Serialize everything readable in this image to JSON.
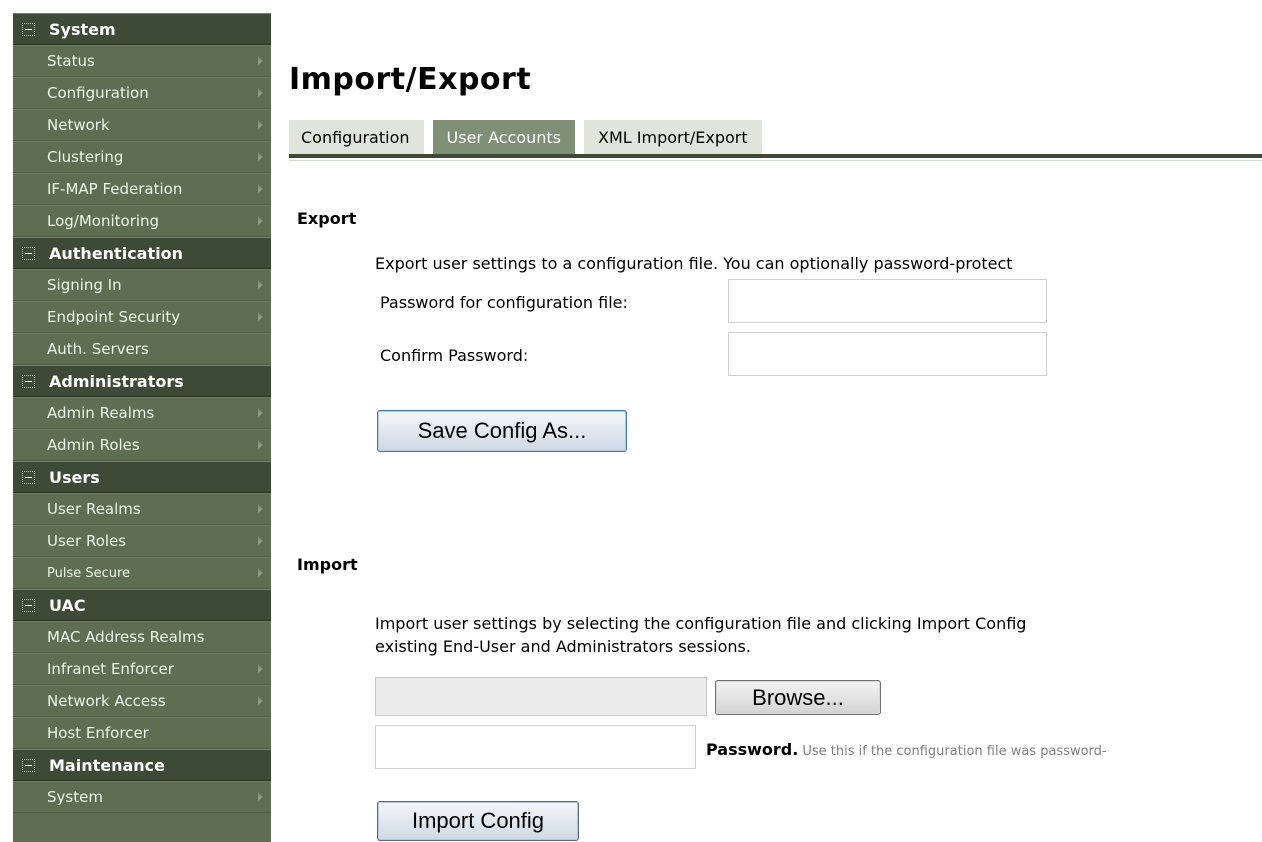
{
  "sidebar": {
    "sections": [
      {
        "title": "System",
        "items": [
          {
            "label": "Status",
            "arrow": true
          },
          {
            "label": "Configuration",
            "arrow": true
          },
          {
            "label": "Network",
            "arrow": true
          },
          {
            "label": "Clustering",
            "arrow": true
          },
          {
            "label": "IF-MAP Federation",
            "arrow": true
          },
          {
            "label": "Log/Monitoring",
            "arrow": true
          }
        ]
      },
      {
        "title": "Authentication",
        "items": [
          {
            "label": "Signing In",
            "arrow": true
          },
          {
            "label": "Endpoint Security",
            "arrow": true
          },
          {
            "label": "Auth. Servers",
            "arrow": false
          }
        ]
      },
      {
        "title": "Administrators",
        "items": [
          {
            "label": "Admin Realms",
            "arrow": true
          },
          {
            "label": "Admin Roles",
            "arrow": true
          }
        ]
      },
      {
        "title": "Users",
        "items": [
          {
            "label": "User Realms",
            "arrow": true
          },
          {
            "label": "User Roles",
            "arrow": true
          },
          {
            "label": "Pulse Secure",
            "arrow": true,
            "small": true
          }
        ]
      },
      {
        "title": "UAC",
        "items": [
          {
            "label": "MAC Address Realms",
            "arrow": false
          },
          {
            "label": "Infranet Enforcer",
            "arrow": true
          },
          {
            "label": "Network Access",
            "arrow": true
          },
          {
            "label": "Host Enforcer",
            "arrow": false
          }
        ]
      },
      {
        "title": "Maintenance",
        "items": [
          {
            "label": "System",
            "arrow": true
          }
        ]
      }
    ]
  },
  "page": {
    "title": "Import/Export"
  },
  "tabs": [
    {
      "label": "Configuration",
      "active": false
    },
    {
      "label": "User Accounts",
      "active": true
    },
    {
      "label": "XML Import/Export",
      "active": false
    }
  ],
  "export": {
    "title": "Export",
    "description": "Export user settings to a configuration file. You can optionally password-protect",
    "password_label": "Password for configuration file:",
    "password_value": "",
    "confirm_label": "Confirm Password:",
    "confirm_value": "",
    "save_button": "Save Config As..."
  },
  "import": {
    "title": "Import",
    "description_line1": "Import user settings by selecting the configuration file and clicking Import Config",
    "description_line2": "existing End-User and Administrators sessions.",
    "file_value": "",
    "browse_button": "Browse...",
    "password_value": "",
    "password_label": "Password.",
    "password_hint": "Use this if the configuration file was password-",
    "import_button": "Import Config"
  },
  "colors": {
    "sidebar_bg": "#5e6e52",
    "sidebar_header_bg": "#3d4a35",
    "tab_active": "#7f9077",
    "tab_inactive": "#dfe5db"
  }
}
